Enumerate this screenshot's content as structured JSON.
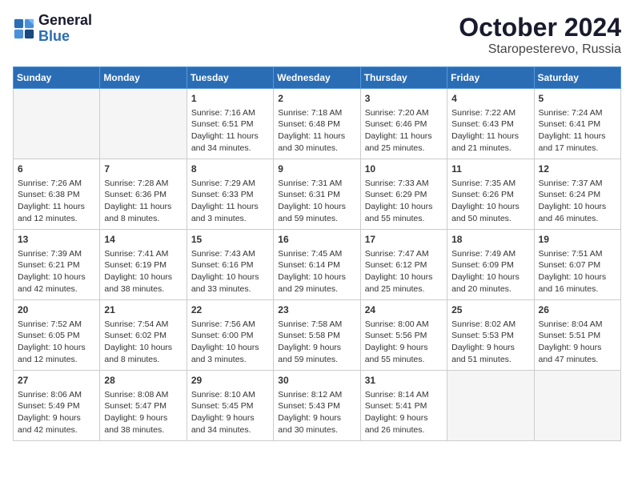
{
  "header": {
    "logo_line1": "General",
    "logo_line2": "Blue",
    "title": "October 2024",
    "subtitle": "Staropesterevo, Russia"
  },
  "days_of_week": [
    "Sunday",
    "Monday",
    "Tuesday",
    "Wednesday",
    "Thursday",
    "Friday",
    "Saturday"
  ],
  "weeks": [
    [
      {
        "day": "",
        "empty": true
      },
      {
        "day": "",
        "empty": true
      },
      {
        "day": "1",
        "sunrise": "Sunrise: 7:16 AM",
        "sunset": "Sunset: 6:51 PM",
        "daylight": "Daylight: 11 hours and 34 minutes."
      },
      {
        "day": "2",
        "sunrise": "Sunrise: 7:18 AM",
        "sunset": "Sunset: 6:48 PM",
        "daylight": "Daylight: 11 hours and 30 minutes."
      },
      {
        "day": "3",
        "sunrise": "Sunrise: 7:20 AM",
        "sunset": "Sunset: 6:46 PM",
        "daylight": "Daylight: 11 hours and 25 minutes."
      },
      {
        "day": "4",
        "sunrise": "Sunrise: 7:22 AM",
        "sunset": "Sunset: 6:43 PM",
        "daylight": "Daylight: 11 hours and 21 minutes."
      },
      {
        "day": "5",
        "sunrise": "Sunrise: 7:24 AM",
        "sunset": "Sunset: 6:41 PM",
        "daylight": "Daylight: 11 hours and 17 minutes."
      }
    ],
    [
      {
        "day": "6",
        "sunrise": "Sunrise: 7:26 AM",
        "sunset": "Sunset: 6:38 PM",
        "daylight": "Daylight: 11 hours and 12 minutes."
      },
      {
        "day": "7",
        "sunrise": "Sunrise: 7:28 AM",
        "sunset": "Sunset: 6:36 PM",
        "daylight": "Daylight: 11 hours and 8 minutes."
      },
      {
        "day": "8",
        "sunrise": "Sunrise: 7:29 AM",
        "sunset": "Sunset: 6:33 PM",
        "daylight": "Daylight: 11 hours and 3 minutes."
      },
      {
        "day": "9",
        "sunrise": "Sunrise: 7:31 AM",
        "sunset": "Sunset: 6:31 PM",
        "daylight": "Daylight: 10 hours and 59 minutes."
      },
      {
        "day": "10",
        "sunrise": "Sunrise: 7:33 AM",
        "sunset": "Sunset: 6:29 PM",
        "daylight": "Daylight: 10 hours and 55 minutes."
      },
      {
        "day": "11",
        "sunrise": "Sunrise: 7:35 AM",
        "sunset": "Sunset: 6:26 PM",
        "daylight": "Daylight: 10 hours and 50 minutes."
      },
      {
        "day": "12",
        "sunrise": "Sunrise: 7:37 AM",
        "sunset": "Sunset: 6:24 PM",
        "daylight": "Daylight: 10 hours and 46 minutes."
      }
    ],
    [
      {
        "day": "13",
        "sunrise": "Sunrise: 7:39 AM",
        "sunset": "Sunset: 6:21 PM",
        "daylight": "Daylight: 10 hours and 42 minutes."
      },
      {
        "day": "14",
        "sunrise": "Sunrise: 7:41 AM",
        "sunset": "Sunset: 6:19 PM",
        "daylight": "Daylight: 10 hours and 38 minutes."
      },
      {
        "day": "15",
        "sunrise": "Sunrise: 7:43 AM",
        "sunset": "Sunset: 6:16 PM",
        "daylight": "Daylight: 10 hours and 33 minutes."
      },
      {
        "day": "16",
        "sunrise": "Sunrise: 7:45 AM",
        "sunset": "Sunset: 6:14 PM",
        "daylight": "Daylight: 10 hours and 29 minutes."
      },
      {
        "day": "17",
        "sunrise": "Sunrise: 7:47 AM",
        "sunset": "Sunset: 6:12 PM",
        "daylight": "Daylight: 10 hours and 25 minutes."
      },
      {
        "day": "18",
        "sunrise": "Sunrise: 7:49 AM",
        "sunset": "Sunset: 6:09 PM",
        "daylight": "Daylight: 10 hours and 20 minutes."
      },
      {
        "day": "19",
        "sunrise": "Sunrise: 7:51 AM",
        "sunset": "Sunset: 6:07 PM",
        "daylight": "Daylight: 10 hours and 16 minutes."
      }
    ],
    [
      {
        "day": "20",
        "sunrise": "Sunrise: 7:52 AM",
        "sunset": "Sunset: 6:05 PM",
        "daylight": "Daylight: 10 hours and 12 minutes."
      },
      {
        "day": "21",
        "sunrise": "Sunrise: 7:54 AM",
        "sunset": "Sunset: 6:02 PM",
        "daylight": "Daylight: 10 hours and 8 minutes."
      },
      {
        "day": "22",
        "sunrise": "Sunrise: 7:56 AM",
        "sunset": "Sunset: 6:00 PM",
        "daylight": "Daylight: 10 hours and 3 minutes."
      },
      {
        "day": "23",
        "sunrise": "Sunrise: 7:58 AM",
        "sunset": "Sunset: 5:58 PM",
        "daylight": "Daylight: 9 hours and 59 minutes."
      },
      {
        "day": "24",
        "sunrise": "Sunrise: 8:00 AM",
        "sunset": "Sunset: 5:56 PM",
        "daylight": "Daylight: 9 hours and 55 minutes."
      },
      {
        "day": "25",
        "sunrise": "Sunrise: 8:02 AM",
        "sunset": "Sunset: 5:53 PM",
        "daylight": "Daylight: 9 hours and 51 minutes."
      },
      {
        "day": "26",
        "sunrise": "Sunrise: 8:04 AM",
        "sunset": "Sunset: 5:51 PM",
        "daylight": "Daylight: 9 hours and 47 minutes."
      }
    ],
    [
      {
        "day": "27",
        "sunrise": "Sunrise: 8:06 AM",
        "sunset": "Sunset: 5:49 PM",
        "daylight": "Daylight: 9 hours and 42 minutes."
      },
      {
        "day": "28",
        "sunrise": "Sunrise: 8:08 AM",
        "sunset": "Sunset: 5:47 PM",
        "daylight": "Daylight: 9 hours and 38 minutes."
      },
      {
        "day": "29",
        "sunrise": "Sunrise: 8:10 AM",
        "sunset": "Sunset: 5:45 PM",
        "daylight": "Daylight: 9 hours and 34 minutes."
      },
      {
        "day": "30",
        "sunrise": "Sunrise: 8:12 AM",
        "sunset": "Sunset: 5:43 PM",
        "daylight": "Daylight: 9 hours and 30 minutes."
      },
      {
        "day": "31",
        "sunrise": "Sunrise: 8:14 AM",
        "sunset": "Sunset: 5:41 PM",
        "daylight": "Daylight: 9 hours and 26 minutes."
      },
      {
        "day": "",
        "empty": true
      },
      {
        "day": "",
        "empty": true
      }
    ]
  ]
}
